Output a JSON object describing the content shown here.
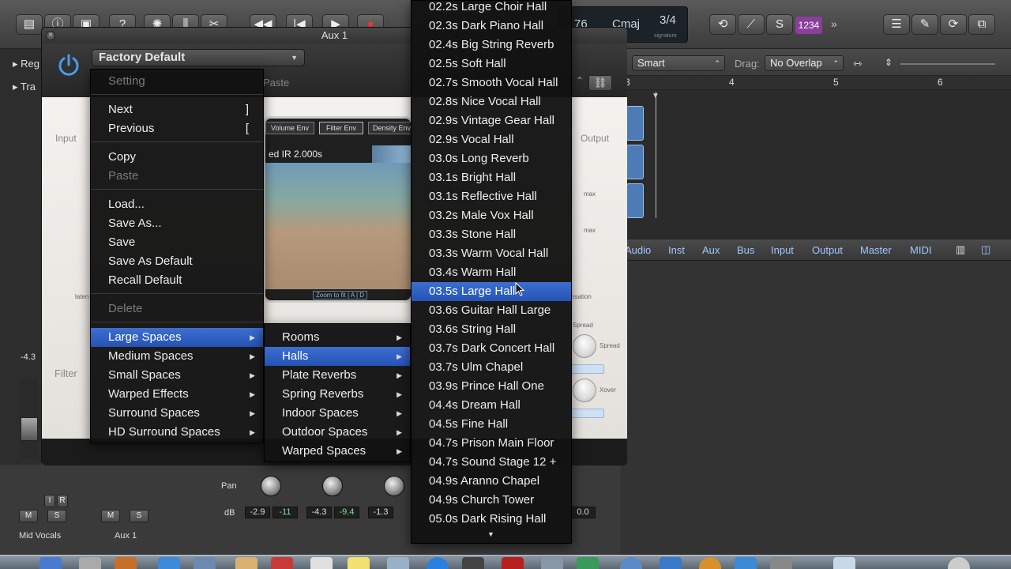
{
  "toolbar": {
    "lcd_tempo": "76",
    "lcd_key": "Cmaj",
    "lcd_signature": "3/4",
    "lcd_signature_label": "signature",
    "count_in": "1234",
    "colors": {
      "accent": "#2a5bc4",
      "count_in_bg": "#8a3f9a"
    }
  },
  "inspector": {
    "labels": [
      "Reg",
      "Tra"
    ]
  },
  "tracks_header": {
    "tool": "Smart",
    "drag_label": "Drag:",
    "drag_mode": "No Overlap",
    "ruler_marks": [
      "3",
      "4",
      "5",
      "6"
    ]
  },
  "mixer": {
    "tabs": [
      "Audio",
      "Inst",
      "Aux",
      "Bus",
      "Input",
      "Output",
      "Master",
      "MIDI"
    ]
  },
  "strips": {
    "pan_label": "Pan",
    "db_label": "dB",
    "values": [
      "-2.9",
      "-11",
      "-4.3",
      "-9.4",
      "-1.3",
      "0.0"
    ],
    "left_value": "-4.3",
    "names": [
      "Mid Vocals",
      "Aux 1"
    ],
    "buttons": {
      "mute": "M",
      "solo": "S",
      "input": "I",
      "record": "R"
    }
  },
  "plugin": {
    "window_title": "Aux 1",
    "preset_name": "Factory Default",
    "paste_label": "Paste",
    "input_label": "Input",
    "output_label": "Output",
    "filter_label": "Filter",
    "env_tabs": [
      "Volume Env",
      "Filter Env",
      "Density Env"
    ],
    "ir_label": "ed IR 2.000s",
    "zoom_label": "Zoom to fit | A | D",
    "knob_labels": [
      "Spread",
      "Spread",
      "Xover"
    ],
    "max_labels": [
      "max",
      "max"
    ],
    "side_labels": [
      "laten",
      "nsation"
    ]
  },
  "preset_menu": {
    "header": "Setting",
    "items": [
      {
        "label": "Next",
        "shortcut": "]",
        "disabled": false
      },
      {
        "label": "Previous",
        "shortcut": "[",
        "disabled": false
      },
      {
        "label": "Copy",
        "disabled": false
      },
      {
        "label": "Paste",
        "disabled": true
      },
      {
        "label": "Load...",
        "disabled": false
      },
      {
        "label": "Save As...",
        "disabled": false
      },
      {
        "label": "Save",
        "disabled": false
      },
      {
        "label": "Save As Default",
        "disabled": false
      },
      {
        "label": "Recall Default",
        "disabled": false
      },
      {
        "label": "Delete",
        "disabled": true
      }
    ],
    "categories": [
      "Large Spaces",
      "Medium Spaces",
      "Small Spaces",
      "Warped Effects",
      "Surround Spaces",
      "HD Surround Spaces"
    ],
    "selected_category": "Large Spaces"
  },
  "submenu": {
    "items": [
      "Rooms",
      "Halls",
      "Plate Reverbs",
      "Spring Reverbs",
      "Indoor Spaces",
      "Outdoor Spaces",
      "Warped Spaces"
    ],
    "selected": "Halls"
  },
  "halls_menu": {
    "items": [
      "02.2s Large Choir Hall",
      "02.3s Dark Piano Hall",
      "02.4s Big String Reverb",
      "02.5s Soft Hall",
      "02.7s Smooth Vocal Hall",
      "02.8s Nice Vocal Hall",
      "02.9s Vintage Gear Hall",
      "02.9s Vocal Hall",
      "03.0s Long Reverb",
      "03.1s Bright Hall",
      "03.1s Reflective Hall",
      "03.2s Male Vox Hall",
      "03.3s Stone Hall",
      "03.3s Warm Vocal Hall",
      "03.4s Warm Hall",
      "03.5s Large Hall",
      "03.6s Guitar Hall Large",
      "03.6s String Hall",
      "03.7s Dark Concert Hall",
      "03.7s Ulm Chapel",
      "03.9s Prince Hall One",
      "04.4s Dream Hall",
      "04.5s Fine Hall",
      "04.7s Prison Main Floor",
      "04.7s Sound Stage 12 +",
      "04.9s Aranno Chapel",
      "04.9s Church Tower",
      "05.0s Dark Rising Hall"
    ],
    "selected": "03.5s Large Hall"
  }
}
